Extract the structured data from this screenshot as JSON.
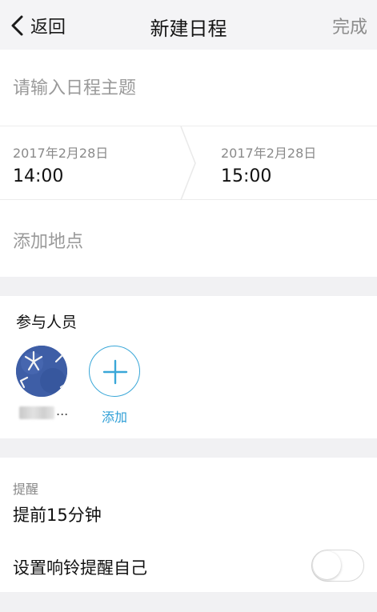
{
  "header": {
    "back_label": "返回",
    "title": "新建日程",
    "done_label": "完成"
  },
  "subject": {
    "placeholder": "请输入日程主题"
  },
  "time": {
    "start": {
      "date": "2017年2月28日",
      "time": "14:00"
    },
    "end": {
      "date": "2017年2月28日",
      "time": "15:00"
    }
  },
  "location": {
    "placeholder": "添加地点"
  },
  "participants": {
    "label": "参与人员",
    "member_name_suffix": "...",
    "add_label": "添加"
  },
  "reminder": {
    "label": "提醒",
    "value": "提前15分钟",
    "ring_self_label": "设置响铃提醒自己",
    "ring_self_enabled": false
  },
  "colors": {
    "accent": "#2d9ed6",
    "background": "#f1f1f3",
    "avatar": "#3e5ea6"
  },
  "icons": {
    "back": "chevron-left-icon",
    "add": "plus-icon",
    "divider": "chevron-divider-icon"
  }
}
